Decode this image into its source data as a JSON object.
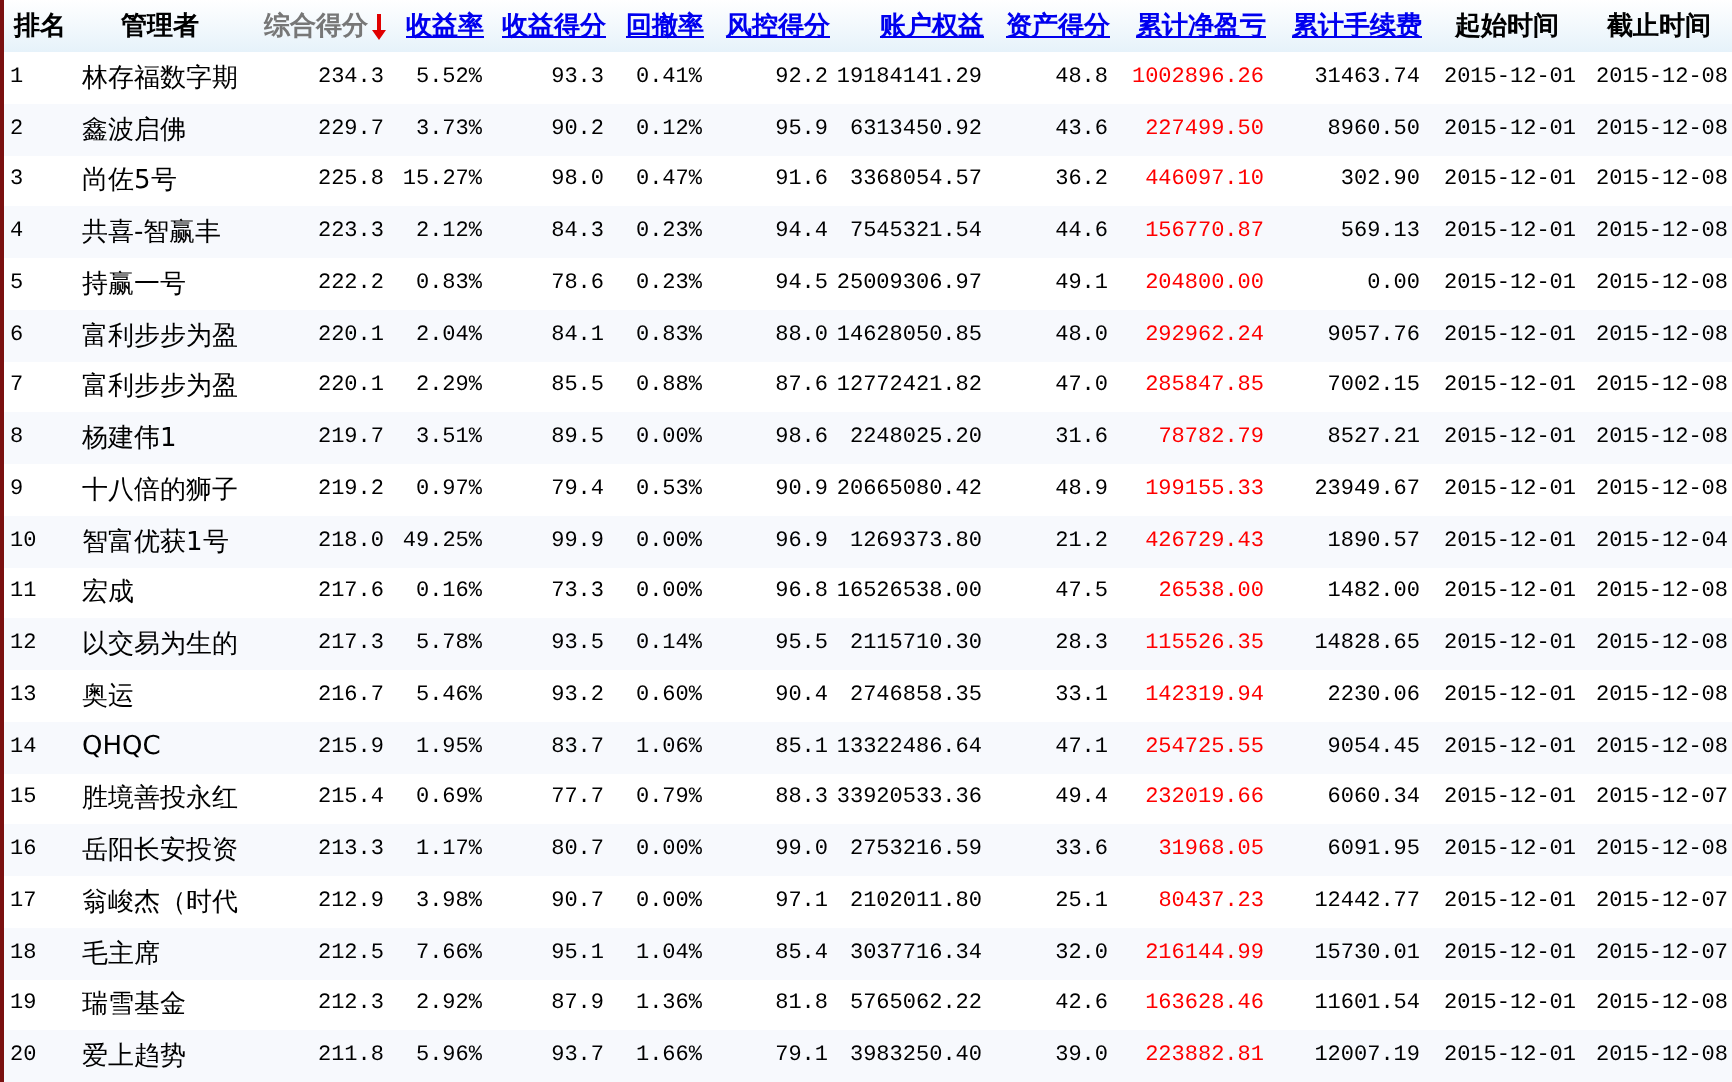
{
  "columns": [
    {
      "label": "排名",
      "kind": "plain"
    },
    {
      "label": "管理者",
      "kind": "plain"
    },
    {
      "label": "综合得分",
      "kind": "sorted"
    },
    {
      "label": "收益率",
      "kind": "link"
    },
    {
      "label": "收益得分",
      "kind": "link"
    },
    {
      "label": "回撤率",
      "kind": "link"
    },
    {
      "label": "风控得分",
      "kind": "link"
    },
    {
      "label": "账户权益",
      "kind": "link"
    },
    {
      "label": "资产得分",
      "kind": "link"
    },
    {
      "label": "累计净盈亏",
      "kind": "link",
      "highlight": true
    },
    {
      "label": "累计手续费",
      "kind": "link"
    },
    {
      "label": "起始时间",
      "kind": "plain"
    },
    {
      "label": "截止时间",
      "kind": "plain"
    }
  ],
  "rows": [
    [
      "1",
      "林存福数字期",
      "234.3",
      "5.52%",
      "93.3",
      "0.41%",
      "92.2",
      "19184141.29",
      "48.8",
      "1002896.26",
      "31463.74",
      "2015-12-01",
      "2015-12-08"
    ],
    [
      "2",
      "鑫波启佛",
      "229.7",
      "3.73%",
      "90.2",
      "0.12%",
      "95.9",
      "6313450.92",
      "43.6",
      "227499.50",
      "8960.50",
      "2015-12-01",
      "2015-12-08"
    ],
    [
      "3",
      "尚佐5号",
      "225.8",
      "15.27%",
      "98.0",
      "0.47%",
      "91.6",
      "3368054.57",
      "36.2",
      "446097.10",
      "302.90",
      "2015-12-01",
      "2015-12-08"
    ],
    [
      "4",
      "共喜-智赢丰",
      "223.3",
      "2.12%",
      "84.3",
      "0.23%",
      "94.4",
      "7545321.54",
      "44.6",
      "156770.87",
      "569.13",
      "2015-12-01",
      "2015-12-08"
    ],
    [
      "5",
      "持赢一号",
      "222.2",
      "0.83%",
      "78.6",
      "0.23%",
      "94.5",
      "25009306.97",
      "49.1",
      "204800.00",
      "0.00",
      "2015-12-01",
      "2015-12-08"
    ],
    [
      "6",
      "富利步步为盈",
      "220.1",
      "2.04%",
      "84.1",
      "0.83%",
      "88.0",
      "14628050.85",
      "48.0",
      "292962.24",
      "9057.76",
      "2015-12-01",
      "2015-12-08"
    ],
    [
      "7",
      "富利步步为盈",
      "220.1",
      "2.29%",
      "85.5",
      "0.88%",
      "87.6",
      "12772421.82",
      "47.0",
      "285847.85",
      "7002.15",
      "2015-12-01",
      "2015-12-08"
    ],
    [
      "8",
      "杨建伟1",
      "219.7",
      "3.51%",
      "89.5",
      "0.00%",
      "98.6",
      "2248025.20",
      "31.6",
      "78782.79",
      "8527.21",
      "2015-12-01",
      "2015-12-08"
    ],
    [
      "9",
      "十八倍的狮子",
      "219.2",
      "0.97%",
      "79.4",
      "0.53%",
      "90.9",
      "20665080.42",
      "48.9",
      "199155.33",
      "23949.67",
      "2015-12-01",
      "2015-12-08"
    ],
    [
      "10",
      "智富优获1号",
      "218.0",
      "49.25%",
      "99.9",
      "0.00%",
      "96.9",
      "1269373.80",
      "21.2",
      "426729.43",
      "1890.57",
      "2015-12-01",
      "2015-12-04"
    ],
    [
      "11",
      "宏成",
      "217.6",
      "0.16%",
      "73.3",
      "0.00%",
      "96.8",
      "16526538.00",
      "47.5",
      "26538.00",
      "1482.00",
      "2015-12-01",
      "2015-12-08"
    ],
    [
      "12",
      "以交易为生的",
      "217.3",
      "5.78%",
      "93.5",
      "0.14%",
      "95.5",
      "2115710.30",
      "28.3",
      "115526.35",
      "14828.65",
      "2015-12-01",
      "2015-12-08"
    ],
    [
      "13",
      "奥运",
      "216.7",
      "5.46%",
      "93.2",
      "0.60%",
      "90.4",
      "2746858.35",
      "33.1",
      "142319.94",
      "2230.06",
      "2015-12-01",
      "2015-12-08"
    ],
    [
      "14",
      "QHQC",
      "215.9",
      "1.95%",
      "83.7",
      "1.06%",
      "85.1",
      "13322486.64",
      "47.1",
      "254725.55",
      "9054.45",
      "2015-12-01",
      "2015-12-08"
    ],
    [
      "15",
      "胜境善投永红",
      "215.4",
      "0.69%",
      "77.7",
      "0.79%",
      "88.3",
      "33920533.36",
      "49.4",
      "232019.66",
      "6060.34",
      "2015-12-01",
      "2015-12-07"
    ],
    [
      "16",
      "岳阳长安投资",
      "213.3",
      "1.17%",
      "80.7",
      "0.00%",
      "99.0",
      "2753216.59",
      "33.6",
      "31968.05",
      "6091.95",
      "2015-12-01",
      "2015-12-08"
    ],
    [
      "17",
      "翁峻杰（时代",
      "212.9",
      "3.98%",
      "90.7",
      "0.00%",
      "97.1",
      "2102011.80",
      "25.1",
      "80437.23",
      "12442.77",
      "2015-12-01",
      "2015-12-07"
    ],
    [
      "18",
      "毛主席",
      "212.5",
      "7.66%",
      "95.1",
      "1.04%",
      "85.4",
      "3037716.34",
      "32.0",
      "216144.99",
      "15730.01",
      "2015-12-01",
      "2015-12-07"
    ],
    [
      "19",
      "瑞雪基金",
      "212.3",
      "2.92%",
      "87.9",
      "1.36%",
      "81.8",
      "5765062.22",
      "42.6",
      "163628.46",
      "11601.54",
      "2015-12-01",
      "2015-12-08"
    ],
    [
      "20",
      "爱上趋势",
      "211.8",
      "5.96%",
      "93.7",
      "1.66%",
      "79.1",
      "3983250.40",
      "39.0",
      "223882.81",
      "12007.19",
      "2015-12-01",
      "2015-12-08"
    ]
  ]
}
